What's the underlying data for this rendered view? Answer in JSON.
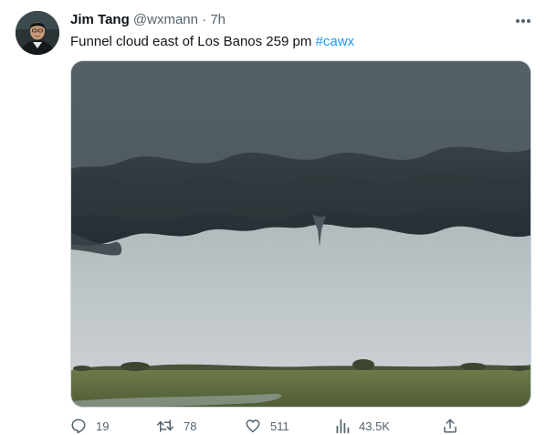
{
  "user": {
    "display_name": "Jim Tang",
    "handle": "@wxmann",
    "separator": "·",
    "time": "7h"
  },
  "tweet": {
    "text": "Funnel cloud east of Los Banos 259 pm ",
    "hashtag": "#cawx"
  },
  "icons": {
    "more": "more-horizontal-icon",
    "reply": "reply-icon",
    "retweet": "retweet-icon",
    "like": "heart-icon",
    "views": "views-chart-icon",
    "share": "share-icon"
  },
  "actions": {
    "replies": "19",
    "retweets": "78",
    "likes": "511",
    "views": "43.5K"
  },
  "colors": {
    "text": "#0f1419",
    "secondary": "#536471",
    "link": "#1d9bf0"
  }
}
